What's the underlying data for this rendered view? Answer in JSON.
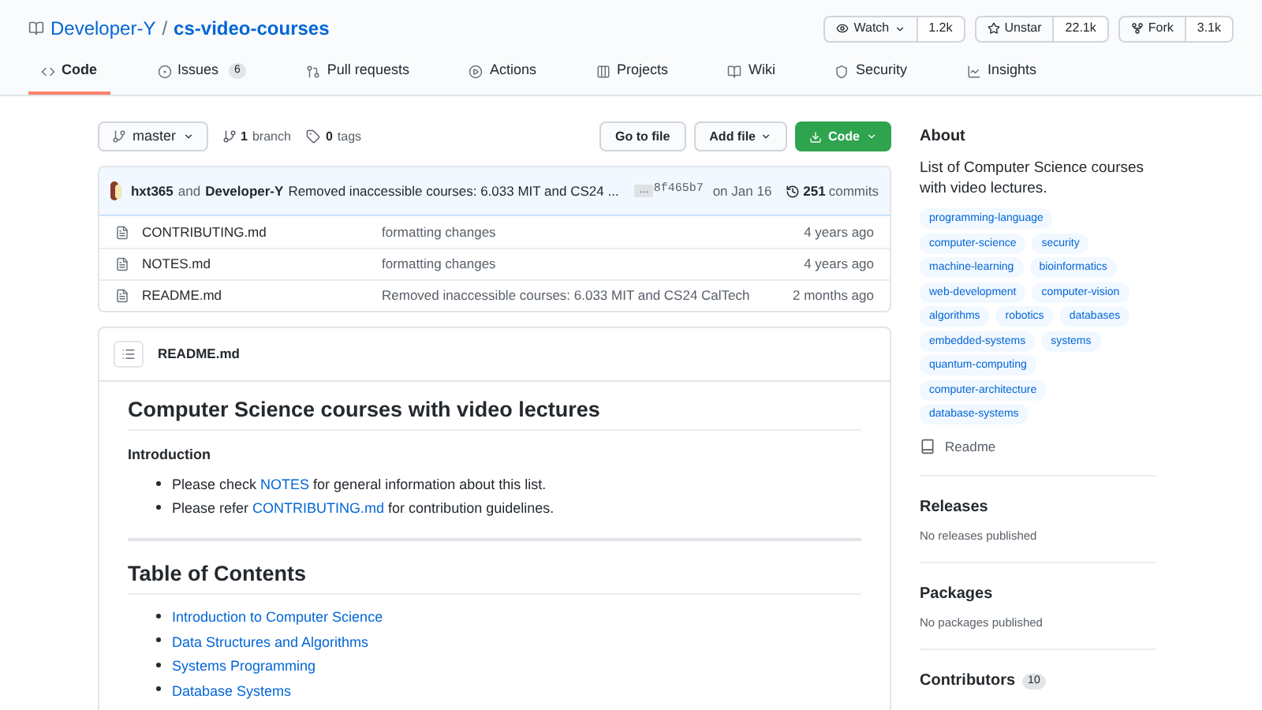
{
  "repo": {
    "owner": "Developer-Y",
    "separator": "/",
    "name": "cs-video-courses"
  },
  "actions": [
    {
      "label": "Watch",
      "count": "1.2k",
      "kind": "watch"
    },
    {
      "label": "Unstar",
      "count": "22.1k",
      "kind": "star"
    },
    {
      "label": "Fork",
      "count": "3.1k",
      "kind": "fork"
    }
  ],
  "tabs": [
    {
      "label": "Code",
      "selected": true,
      "kind": "code"
    },
    {
      "label": "Issues",
      "count": "6",
      "selected": false,
      "kind": "issue"
    },
    {
      "label": "Pull requests",
      "selected": false,
      "kind": "pr"
    },
    {
      "label": "Actions",
      "selected": false,
      "kind": "play"
    },
    {
      "label": "Projects",
      "selected": false,
      "kind": "project"
    },
    {
      "label": "Wiki",
      "selected": false,
      "kind": "book"
    },
    {
      "label": "Security",
      "selected": false,
      "kind": "shield"
    },
    {
      "label": "Insights",
      "selected": false,
      "kind": "graph"
    }
  ],
  "branch": {
    "name": "master",
    "branches_count": "1",
    "branches_label": "branch",
    "tags_count": "0",
    "tags_label": "tags"
  },
  "buttons": {
    "go_to_file": "Go to file",
    "add_file": "Add file",
    "code": "Code"
  },
  "commit": {
    "author": "hxt365",
    "joiner": "and",
    "coauthor": "Developer-Y",
    "message": "Removed inaccessible courses: 6.033 MIT and CS24 ...",
    "ellipsis": "…",
    "sha": "8f465b7",
    "date": "on Jan 16",
    "commits_count": "251",
    "commits_label": "commits"
  },
  "files": [
    {
      "name": "CONTRIBUTING.md",
      "message": "formatting changes",
      "age": "4 years ago"
    },
    {
      "name": "NOTES.md",
      "message": "formatting changes",
      "age": "4 years ago"
    },
    {
      "name": "README.md",
      "message": "Removed inaccessible courses: 6.033 MIT and CS24 CalTech",
      "age": "2 months ago"
    }
  ],
  "readme": {
    "filename": "README.md",
    "title": "Computer Science courses with video lectures",
    "intro_heading": "Introduction",
    "intro_items": [
      {
        "before": "Please check ",
        "link": "NOTES",
        "after": " for general information about this list."
      },
      {
        "before": "Please refer ",
        "link": "CONTRIBUTING.md",
        "after": " for contribution guidelines."
      }
    ],
    "toc_heading": "Table of Contents",
    "toc": [
      "Introduction to Computer Science",
      "Data Structures and Algorithms",
      "Systems Programming",
      "Database Systems"
    ]
  },
  "about": {
    "heading": "About",
    "description": "List of Computer Science courses with video lectures.",
    "topics": [
      "programming-language",
      "computer-science",
      "security",
      "machine-learning",
      "bioinformatics",
      "web-development",
      "computer-vision",
      "algorithms",
      "robotics",
      "databases",
      "embedded-systems",
      "systems",
      "quantum-computing",
      "computer-architecture",
      "database-systems"
    ],
    "readme_link": "Readme"
  },
  "sections": [
    {
      "heading": "Releases",
      "note": "No releases published"
    },
    {
      "heading": "Packages",
      "note": "No packages published"
    },
    {
      "heading": "Contributors",
      "count": "10"
    }
  ]
}
